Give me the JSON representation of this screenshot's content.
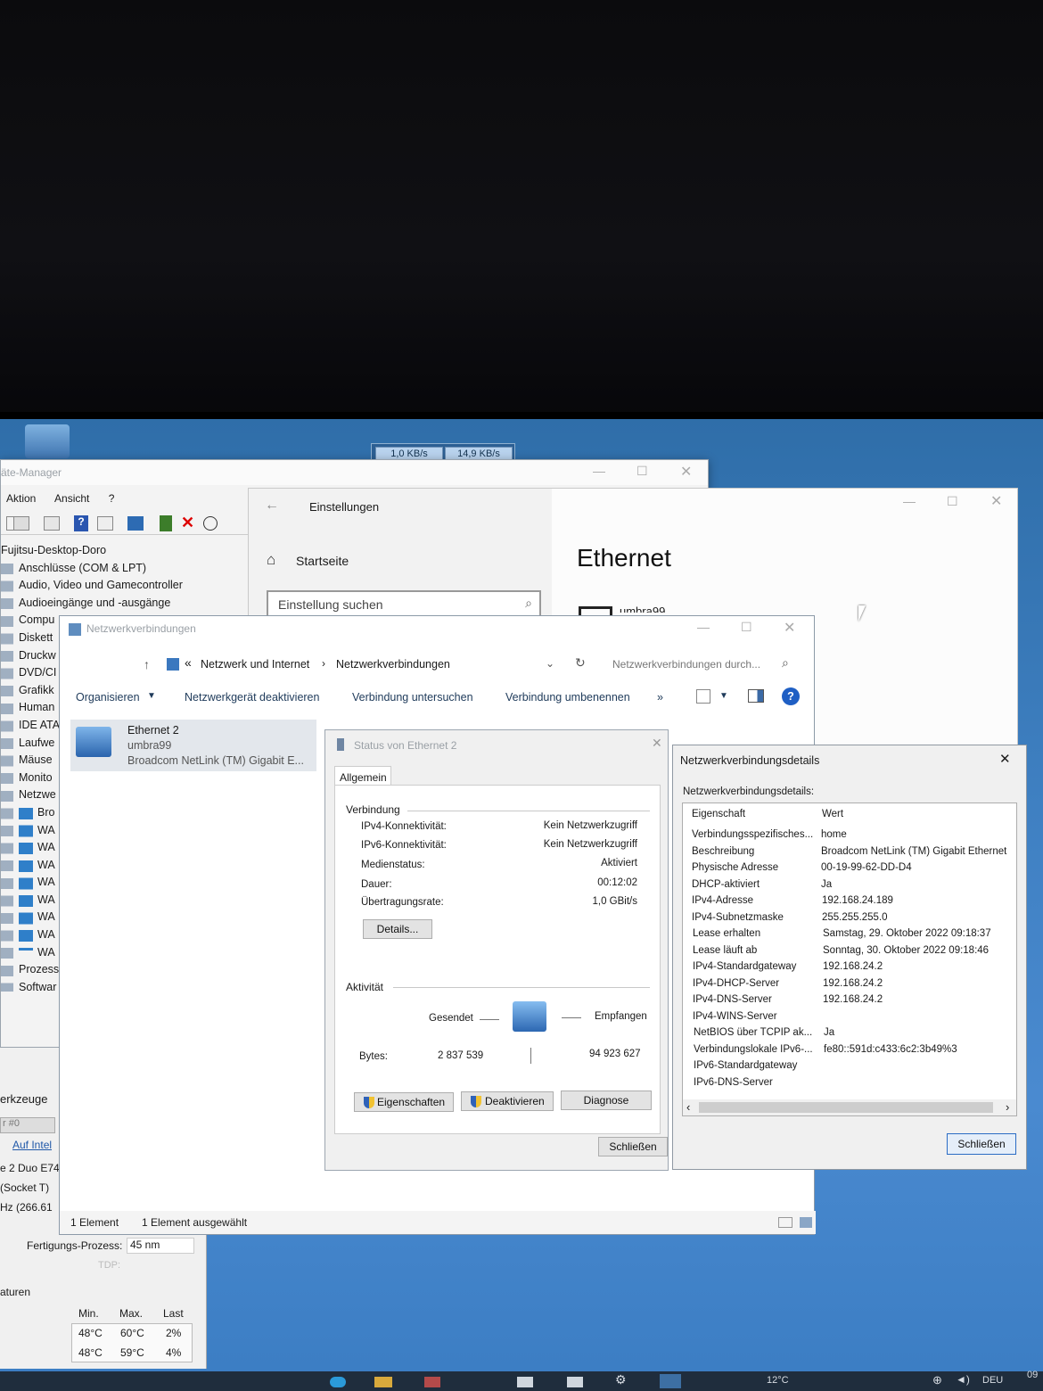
{
  "netspeed": {
    "upload": "1,0 KB/s",
    "download": "14,9 KB/s"
  },
  "devmgr": {
    "title": "äte-Manager",
    "menu": [
      "Aktion",
      "Ansicht",
      "?"
    ],
    "tree": [
      "Fujitsu-Desktop-Doro",
      "Anschlüsse (COM & LPT)",
      "Audio, Video und Gamecontroller",
      "Audioeingänge und -ausgänge",
      "Compu",
      "Diskett",
      "Druckw",
      "DVD/CI",
      "Grafikk",
      "Human",
      "IDE ATA",
      "Laufwe",
      "Mäuse",
      "Monito",
      "Netzwe",
      "Bro",
      "WA",
      "WA",
      "WA",
      "WA",
      "WA",
      "WA",
      "WA",
      "WA",
      "Prozess",
      "Softwar"
    ]
  },
  "cpu": {
    "tools_label": "erkzeuge",
    "proc_label": "r #0",
    "intel_link": "Auf Intel",
    "cpu_name": "e 2 Duo E74",
    "socket": "(Socket T)",
    "clock": "Hz (266.61",
    "process_label": "Fertigungs-Prozess:",
    "process_value": "45 nm",
    "tdp_label": "TDP:",
    "temps_label": "aturen",
    "headers": [
      "Min.",
      "Max.",
      "Last"
    ],
    "rows": [
      [
        "48°C",
        "60°C",
        "2%"
      ],
      [
        "48°C",
        "59°C",
        "4%"
      ]
    ]
  },
  "settings": {
    "title": "Einstellungen",
    "home": "Startseite",
    "search_placeholder": "Einstellung suchen",
    "page_title": "Ethernet",
    "network_partial": "umbra99"
  },
  "netconn": {
    "title": "Netzwerkverbindungen",
    "breadcrumb": [
      "Netzwerk und Internet",
      "Netzwerkverbindungen"
    ],
    "search_placeholder": "Netzwerkverbindungen durch...",
    "commands": [
      "Organisieren",
      "Netzwerkgerät deaktivieren",
      "Verbindung untersuchen",
      "Verbindung umbenennen"
    ],
    "adapter": {
      "name": "Ethernet 2",
      "network": "umbra99",
      "device": "Broadcom NetLink (TM) Gigabit E..."
    },
    "status_left": "1 Element",
    "status_right": "1 Element ausgewählt"
  },
  "status_dialog": {
    "title": "Status von Ethernet 2",
    "tab": "Allgemein",
    "connection_group": "Verbindung",
    "rows": [
      {
        "label": "IPv4-Konnektivität:",
        "value": "Kein Netzwerkzugriff"
      },
      {
        "label": "IPv6-Konnektivität:",
        "value": "Kein Netzwerkzugriff"
      },
      {
        "label": "Medienstatus:",
        "value": "Aktiviert"
      },
      {
        "label": "Dauer:",
        "value": "00:12:02"
      },
      {
        "label": "Übertragungsrate:",
        "value": "1,0 GBit/s"
      }
    ],
    "details_button": "Details...",
    "activity_group": "Aktivität",
    "sent_label": "Gesendet",
    "received_label": "Empfangen",
    "bytes_label": "Bytes:",
    "bytes_sent": "2 837 539",
    "bytes_received": "94 923 627",
    "buttons": [
      "Eigenschaften",
      "Deaktivieren",
      "Diagnose"
    ],
    "close_button": "Schließen"
  },
  "details_dialog": {
    "title": "Netzwerkverbindungsdetails",
    "caption": "Netzwerkverbindungsdetails:",
    "header": {
      "property": "Eigenschaft",
      "value": "Wert"
    },
    "rows": [
      {
        "property": "Verbindungsspezifisches...",
        "value": "home"
      },
      {
        "property": "Beschreibung",
        "value": "Broadcom NetLink (TM) Gigabit Ethernet"
      },
      {
        "property": "Physische Adresse",
        "value": "00-19-99-62-DD-D4"
      },
      {
        "property": "DHCP-aktiviert",
        "value": "Ja"
      },
      {
        "property": "IPv4-Adresse",
        "value": "192.168.24.189"
      },
      {
        "property": "IPv4-Subnetzmaske",
        "value": "255.255.255.0"
      },
      {
        "property": "Lease erhalten",
        "value": "Samstag, 29. Oktober 2022 09:18:37"
      },
      {
        "property": "Lease läuft ab",
        "value": "Sonntag, 30. Oktober 2022 09:18:46"
      },
      {
        "property": "IPv4-Standardgateway",
        "value": "192.168.24.2"
      },
      {
        "property": "IPv4-DHCP-Server",
        "value": "192.168.24.2"
      },
      {
        "property": "IPv4-DNS-Server",
        "value": "192.168.24.2"
      },
      {
        "property": "IPv4-WINS-Server",
        "value": ""
      },
      {
        "property": "NetBIOS über TCPIP ak...",
        "value": "Ja"
      },
      {
        "property": "Verbindungslokale IPv6-...",
        "value": "fe80::591d:c433:6c2:3b49%3"
      },
      {
        "property": "IPv6-Standardgateway",
        "value": ""
      },
      {
        "property": "IPv6-DNS-Server",
        "value": ""
      }
    ],
    "close_button": "Schließen"
  },
  "taskbar": {
    "weather": "12°C",
    "language": "DEU",
    "clock": "09"
  },
  "colors": {
    "desktop": "#3f80c2",
    "accent": "#2b6cc4",
    "taskbar": "#1f2d3d"
  }
}
